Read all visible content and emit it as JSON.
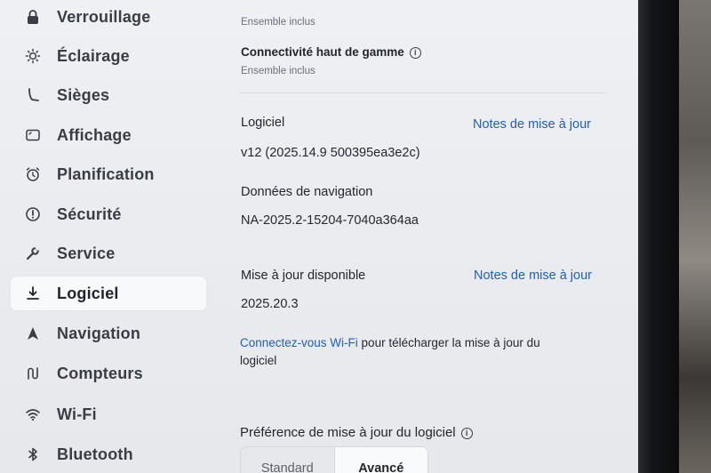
{
  "sidebar": {
    "items": [
      {
        "label": "Verrouillage",
        "icon": "lock-icon"
      },
      {
        "label": "Éclairage",
        "icon": "sun-icon"
      },
      {
        "label": "Sièges",
        "icon": "seat-icon"
      },
      {
        "label": "Affichage",
        "icon": "display-icon"
      },
      {
        "label": "Planification",
        "icon": "alarm-clock-icon"
      },
      {
        "label": "Sécurité",
        "icon": "alert-circle-icon"
      },
      {
        "label": "Service",
        "icon": "wrench-icon"
      },
      {
        "label": "Logiciel",
        "icon": "download-icon",
        "active": true
      },
      {
        "label": "Navigation",
        "icon": "navigation-arrow-icon"
      },
      {
        "label": "Compteurs",
        "icon": "trip-meter-icon"
      },
      {
        "label": "Wi-Fi",
        "icon": "wifi-icon"
      },
      {
        "label": "Bluetooth",
        "icon": "bluetooth-icon"
      }
    ]
  },
  "content": {
    "prev_sub": "Ensemble inclus",
    "connectivity": {
      "title": "Connectivité haut de gamme",
      "sub": "Ensemble inclus"
    },
    "software": {
      "label": "Logiciel",
      "notes_link": "Notes de mise à jour",
      "version": "v12 (2025.14.9 500395ea3e2c)"
    },
    "navdata": {
      "label": "Données de navigation",
      "value": "NA-2025.2-15204-7040a364aa"
    },
    "update": {
      "label": "Mise à jour disponible",
      "notes_link": "Notes de mise à jour",
      "version": "2025.20.3"
    },
    "wifi_msg": {
      "link": "Connectez-vous Wi-Fi",
      "rest": " pour télécharger la mise à jour du",
      "line2": "logiciel"
    },
    "preference": {
      "title": "Préférence de mise à jour du logiciel",
      "options": [
        "Standard",
        "Avancé"
      ],
      "selected": "Avancé"
    }
  },
  "colors": {
    "accent": "#1f5fb6",
    "text": "#23262c",
    "screen_bg": "#eceef2"
  }
}
